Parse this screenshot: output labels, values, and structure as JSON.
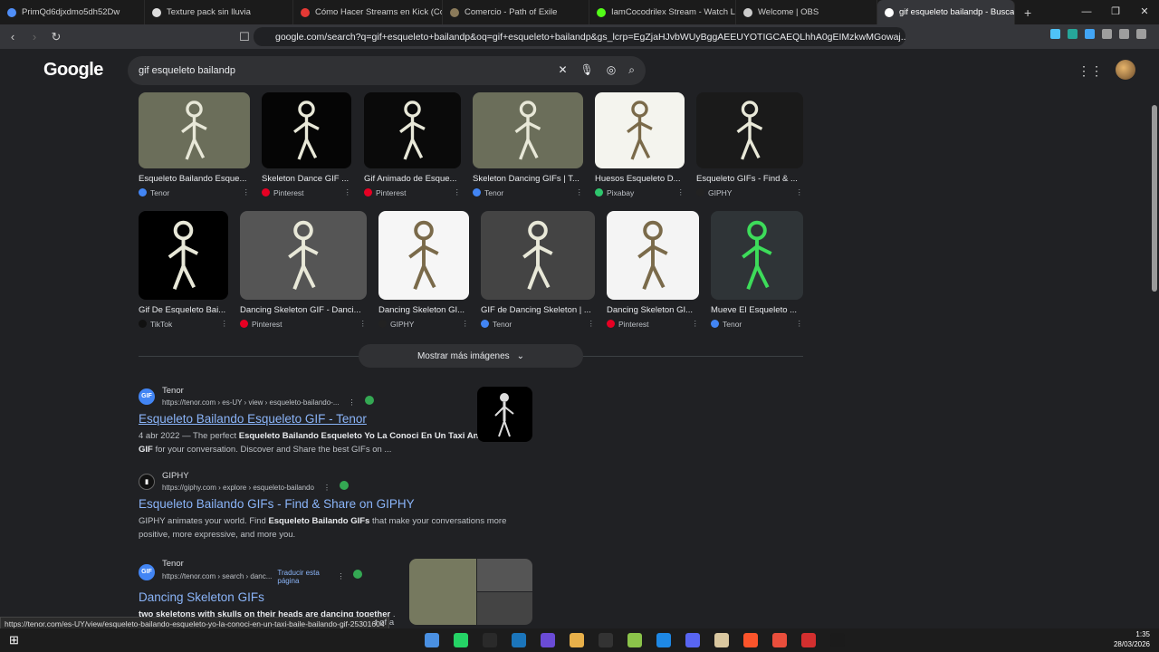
{
  "tabs": [
    {
      "label": "PrimQd6djxdmo5dh52Dw",
      "color": "#4f8ef7"
    },
    {
      "label": "Texture pack sin lluvia",
      "color": "#dddddd"
    },
    {
      "label": "Cómo Hacer Streams en Kick (Config",
      "color": "#e53935"
    },
    {
      "label": "Comercio - Path of Exile",
      "color": "#8a7a5a"
    },
    {
      "label": "IamCocodrilex Stream - Watch Live o",
      "color": "#53fc18"
    },
    {
      "label": "Welcome | OBS",
      "color": "#cccccc"
    },
    {
      "label": "gif esqueleto bailandp - Buscar",
      "color": "#ffffff",
      "active": true
    }
  ],
  "url": "google.com/search?q=gif+esqueleto+bailandp&oq=gif+esqueleto+bailandp&gs_lcrp=EgZjaHJvbWUyBggAEEUYOTIGCAEQLhhA0gEIMzkwMGowaj...",
  "logo": "Google",
  "search": {
    "query": "gif esqueleto bailandp"
  },
  "images_row1": [
    {
      "title": "Esqueleto Bailando Esque...",
      "source": "Tenor",
      "src_color": "#4285f4",
      "bg": "#6b6e5a"
    },
    {
      "title": "Skeleton Dance GIF ...",
      "source": "Pinterest",
      "src_color": "#e60023",
      "bg": "#050505"
    },
    {
      "title": "Gif Animado de Esque...",
      "source": "Pinterest",
      "src_color": "#e60023",
      "bg": "#0a0a0a"
    },
    {
      "title": "Skeleton Dancing GIFs | T...",
      "source": "Tenor",
      "src_color": "#4285f4",
      "bg": "#6b6e5a"
    },
    {
      "title": "Huesos Esqueleto D...",
      "source": "Pixabay",
      "src_color": "#2ec66d",
      "bg": "#f4f4ee"
    },
    {
      "title": "Esqueleto GIFs - Find & ...",
      "source": "GIPHY",
      "src_color": "#222222",
      "bg": "#1a1a1a"
    }
  ],
  "images_row2": [
    {
      "title": "Gif De Esqueleto Bai...",
      "source": "TikTok",
      "src_color": "#111111",
      "bg": "#000000"
    },
    {
      "title": "Dancing Skeleton GIF - Danci...",
      "source": "Pinterest",
      "src_color": "#e60023",
      "bg": "#555555"
    },
    {
      "title": "Dancing Skeleton GI...",
      "source": "GIPHY",
      "src_color": "#222222",
      "bg": "#f6f6f6"
    },
    {
      "title": "GIF de Dancing Skeleton | ...",
      "source": "Tenor",
      "src_color": "#4285f4",
      "bg": "#444444"
    },
    {
      "title": "Dancing Skeleton GI...",
      "source": "Pinterest",
      "src_color": "#e60023",
      "bg": "#f4f4f4"
    },
    {
      "title": "Mueve El Esqueleto ...",
      "source": "Tenor",
      "src_color": "#4285f4",
      "bg": "#2f3437"
    }
  ],
  "more_images": "Mostrar más imágenes",
  "results": [
    {
      "site": "Tenor",
      "url": "https://tenor.com › es-UY › view › esqueleto-bailando-...",
      "title": "Esqueleto Bailando Esqueleto GIF - Tenor",
      "snippet_date": "4 abr 2022",
      "snippet_a": " — The perfect ",
      "snippet_b": "Esqueleto Bailando Esqueleto Yo La Conoci En Un Taxi Animated GIF",
      "snippet_c": " for your conversation. Discover and Share the best GIFs on ..."
    },
    {
      "site": "GIPHY",
      "url": "https://giphy.com › explore › esqueleto-bailando",
      "title": "Esqueleto Bailando GIFs - Find & Share on GIPHY",
      "snippet_a": "GIPHY animates your world. Find ",
      "snippet_b": "Esqueleto Bailando GIFs",
      "snippet_c": " that make your conversations more positive, more expressive, and more you."
    },
    {
      "site": "Tenor",
      "url": "https://tenor.com › search › danc...",
      "translate": "Traducir esta página",
      "title": "Dancing Skeleton GIFs",
      "snippet_b": "two skeletons with skulls on their heads are dancing together",
      "snippet_c": " ."
    }
  ],
  "status_url": "https://tenor.com/es-UY/view/esqueleto-bailando-esqueleto-yo-la-conoci-en-un-taxi-baile-bailando-gif-25301604",
  "status_tail": "t of a",
  "clock": {
    "time": "1:35",
    "date": "28/03/2026"
  },
  "taskbar_colors": [
    "#4a90e2",
    "#25d366",
    "#2a2a2a",
    "#1b75bb",
    "#6a4bd6",
    "#e8b04a",
    "#333333",
    "#8bc34a",
    "#1e88e5",
    "#5865f2",
    "#d9c7a0",
    "#fb542b",
    "#e94e3c",
    "#d32f2f",
    "#1b1b1b"
  ]
}
